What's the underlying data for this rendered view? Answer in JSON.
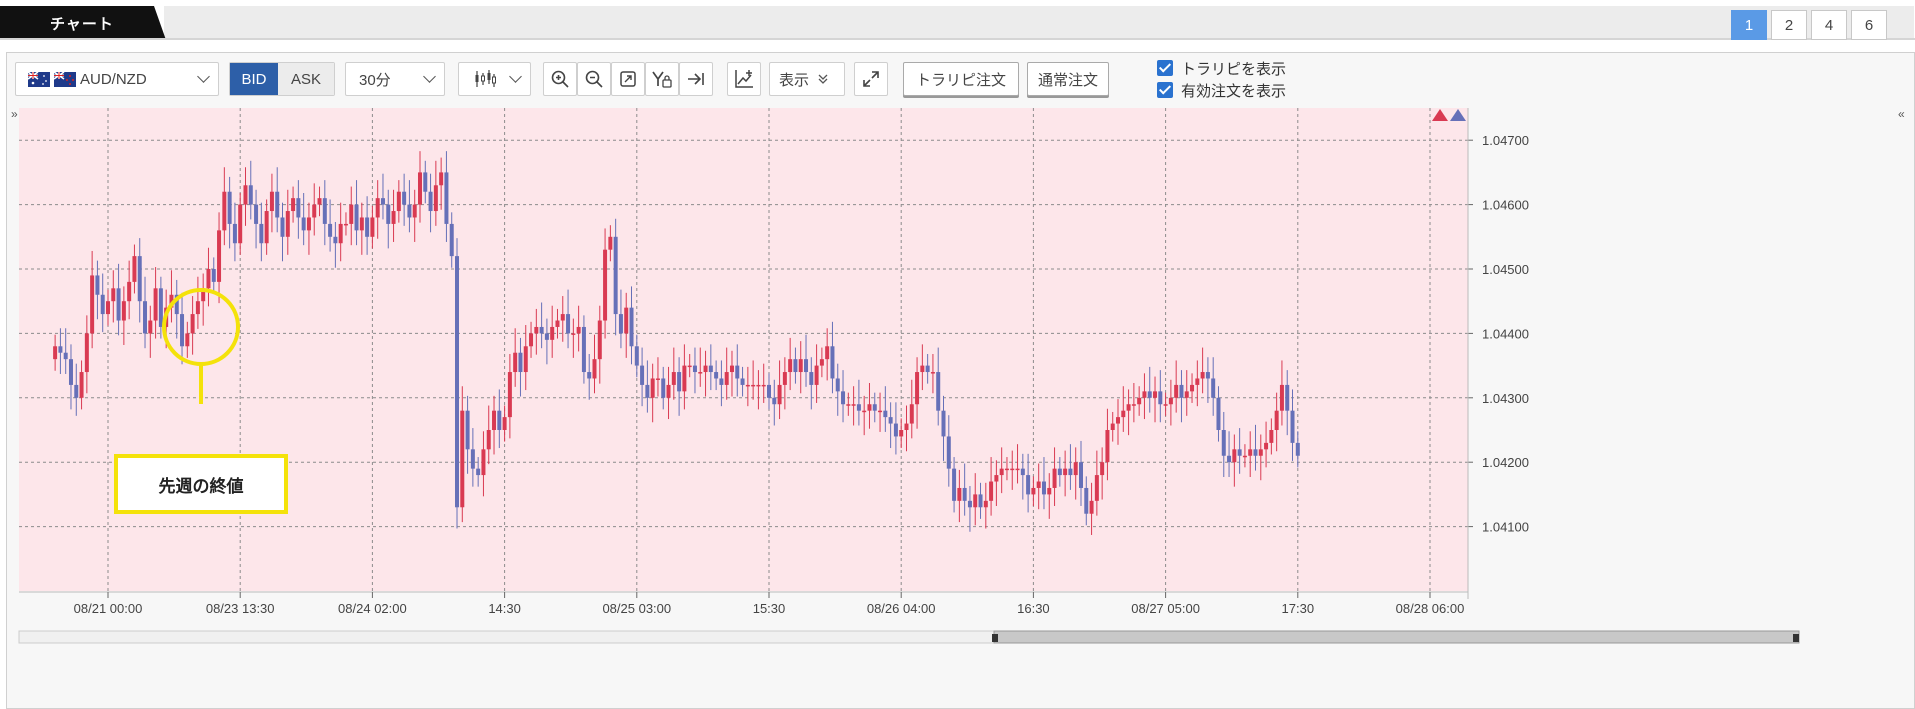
{
  "topbar": {
    "tab_label": "チャート",
    "layout_buttons": [
      "1",
      "2",
      "4",
      "6"
    ],
    "active_layout": "1"
  },
  "toolbar": {
    "symbol": "AUD/NZD",
    "bid_label": "BID",
    "ask_label": "ASK",
    "interval": "30分",
    "display_label": "表示",
    "tp_order_label": "トラリピ注文",
    "normal_order_label": "通常注文",
    "show_tp_label": "トラリピを表示",
    "show_orders_label": "有効注文を表示",
    "show_tp_checked": true,
    "show_orders_checked": true,
    "icons": [
      "zoom-in-icon",
      "zoom-out-icon",
      "fit-icon",
      "y-lock-icon",
      "scroll-right-icon",
      "indicator-icon"
    ]
  },
  "annotation": {
    "label": "先週の終値"
  },
  "colors": {
    "plot_bg": "#fde6ea",
    "up": "#d93a52",
    "down": "#6670b8",
    "grid": "#8c8c8c",
    "highlight": "#f4e20a",
    "accent": "#5a9ae6"
  },
  "chart_data": {
    "type": "candlestick",
    "symbol": "AUD/NZD",
    "price_side": "BID",
    "timeframe": "30分",
    "ylim": [
      1.04,
      1.0475
    ],
    "y_ticks": [
      "1.04700",
      "1.04600",
      "1.04500",
      "1.04400",
      "1.04300",
      "1.04200",
      "1.04100"
    ],
    "x_ticks": [
      "08/21 00:00",
      "08/23 13:30",
      "08/24 02:00",
      "14:30",
      "08/25 03:00",
      "15:30",
      "08/26 04:00",
      "16:30",
      "08/27 05:00",
      "17:30",
      "08/28 06:00"
    ],
    "grid": true,
    "candles_per_tick": 25,
    "closes": [
      1.0438,
      1.0437,
      1.0436,
      1.0432,
      1.043,
      1.0434,
      1.044,
      1.0449,
      1.0446,
      1.0443,
      1.0445,
      1.0447,
      1.0442,
      1.0445,
      1.0448,
      1.0452,
      1.0445,
      1.044,
      1.0442,
      1.0447,
      1.0441,
      1.0444,
      1.0446,
      1.0443,
      1.0438,
      1.044,
      1.0443,
      1.0445,
      1.0447,
      1.045,
      1.0448,
      1.0456,
      1.0462,
      1.0457,
      1.0454,
      1.046,
      1.0463,
      1.046,
      1.0457,
      1.0454,
      1.0459,
      1.0462,
      1.0458,
      1.0455,
      1.0459,
      1.0461,
      1.0458,
      1.0456,
      1.0458,
      1.046,
      1.0461,
      1.0457,
      1.0455,
      1.0454,
      1.0457,
      1.0457,
      1.046,
      1.0456,
      1.0458,
      1.0455,
      1.0458,
      1.0461,
      1.046,
      1.0457,
      1.0459,
      1.0462,
      1.046,
      1.0458,
      1.046,
      1.0465,
      1.0462,
      1.0459,
      1.0463,
      1.0465,
      1.0457,
      1.0452,
      1.0413,
      1.0428,
      1.0422,
      1.0419,
      1.0418,
      1.0422,
      1.0425,
      1.0428,
      1.0425,
      1.0427,
      1.0434,
      1.0437,
      1.0434,
      1.0438,
      1.044,
      1.0441,
      1.044,
      1.0439,
      1.0441,
      1.0442,
      1.0443,
      1.044,
      1.044,
      1.0441,
      1.0434,
      1.0433,
      1.0436,
      1.0442,
      1.0453,
      1.0455,
      1.0443,
      1.044,
      1.0444,
      1.0438,
      1.0435,
      1.0432,
      1.043,
      1.0433,
      1.0433,
      1.043,
      1.0432,
      1.0434,
      1.0431,
      1.0435,
      1.0435,
      1.0434,
      1.0434,
      1.0435,
      1.0434,
      1.0433,
      1.0432,
      1.0434,
      1.0435,
      1.0433,
      1.0432,
      1.0432,
      1.0432,
      1.0432,
      1.0432,
      1.043,
      1.0429,
      1.0432,
      1.0434,
      1.0436,
      1.0434,
      1.0436,
      1.0434,
      1.0432,
      1.0435,
      1.0436,
      1.0438,
      1.0433,
      1.0431,
      1.0429,
      1.0429,
      1.0429,
      1.0428,
      1.0428,
      1.0429,
      1.0428,
      1.0428,
      1.0427,
      1.0426,
      1.0424,
      1.0425,
      1.0426,
      1.0429,
      1.0434,
      1.0435,
      1.0434,
      1.0434,
      1.0428,
      1.0424,
      1.0419,
      1.0414,
      1.0416,
      1.0414,
      1.0413,
      1.0415,
      1.0413,
      1.0414,
      1.0417,
      1.0418,
      1.0419,
      1.0419,
      1.0419,
      1.0419,
      1.0418,
      1.0415,
      1.0416,
      1.0417,
      1.0415,
      1.0416,
      1.0419,
      1.0418,
      1.0419,
      1.0418,
      1.042,
      1.0416,
      1.0412,
      1.0414,
      1.0418,
      1.042,
      1.0425,
      1.0426,
      1.0427,
      1.0428,
      1.0429,
      1.0429,
      1.043,
      1.0431,
      1.043,
      1.0431,
      1.0429,
      1.0429,
      1.043,
      1.0432,
      1.043,
      1.0431,
      1.0432,
      1.0433,
      1.0434,
      1.0433,
      1.043,
      1.0425,
      1.0421,
      1.042,
      1.0422,
      1.0421,
      1.0421,
      1.0422,
      1.0421,
      1.0422,
      1.0423,
      1.0425,
      1.0428,
      1.0432,
      1.0428,
      1.0423,
      1.0421
    ]
  }
}
